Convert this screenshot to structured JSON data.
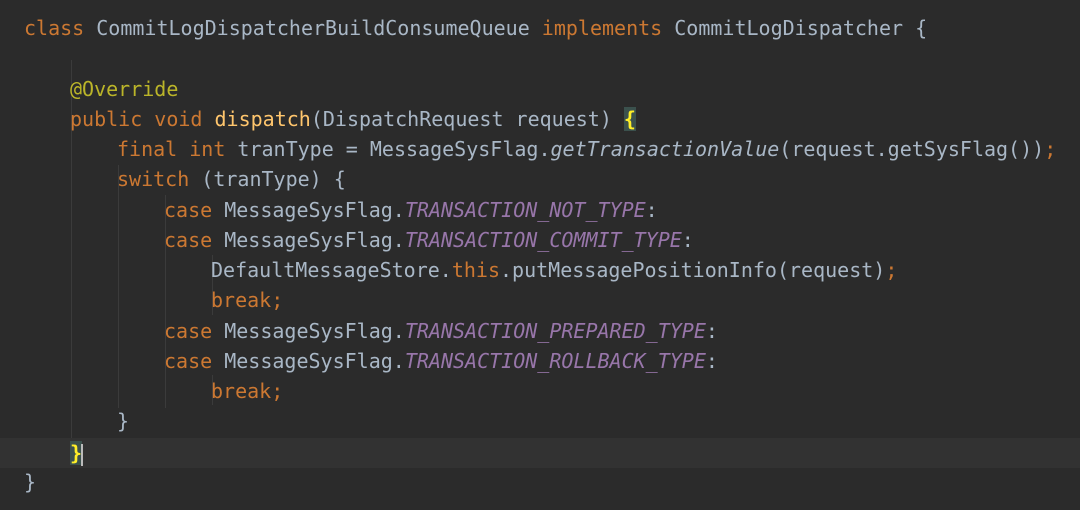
{
  "editor": {
    "language": "Java",
    "theme_colors": {
      "background": "#2b2b2b",
      "keyword": "#cc7832",
      "method": "#ffc66d",
      "annotation": "#bbb529",
      "constant": "#9876aa",
      "text": "#a9b7c6",
      "brace_match": "#ffef28"
    },
    "code": {
      "l1": {
        "kw_class": "class",
        "class_name": " CommitLogDispatcherBuildConsumeQueue ",
        "kw_implements": "implements",
        "iface": " CommitLogDispatcher {"
      },
      "l3": {
        "annotation": "@Override"
      },
      "l4": {
        "kw_public": "public",
        "kw_void": "void",
        "method": "dispatch",
        "params": "(DispatchRequest request) ",
        "brace": "{"
      },
      "l5": {
        "kw_final": "final",
        "kw_int": "int",
        "decl": " tranType = MessageSysFlag.",
        "call": "getTransactionValue",
        "args": "(request.getSysFlag())",
        "semi": ";"
      },
      "l6": {
        "kw_switch": "switch",
        "rest": " (tranType) {"
      },
      "l7": {
        "kw_case": "case",
        "cls": " MessageSysFlag.",
        "const": "TRANSACTION_NOT_TYPE",
        "colon": ":"
      },
      "l8": {
        "kw_case": "case",
        "cls": " MessageSysFlag.",
        "const": "TRANSACTION_COMMIT_TYPE",
        "colon": ":"
      },
      "l9": {
        "pre": "DefaultMessageStore.",
        "kw_this": "this",
        "post": ".putMessagePositionInfo(request)",
        "semi": ";"
      },
      "l10": {
        "kw_break": "break",
        "semi": ";"
      },
      "l11": {
        "kw_case": "case",
        "cls": " MessageSysFlag.",
        "const": "TRANSACTION_PREPARED_TYPE",
        "colon": ":"
      },
      "l12": {
        "kw_case": "case",
        "cls": " MessageSysFlag.",
        "const": "TRANSACTION_ROLLBACK_TYPE",
        "colon": ":"
      },
      "l13": {
        "kw_break": "break",
        "semi": ";"
      },
      "l14": {
        "brace": "}"
      },
      "l15": {
        "brace": "}"
      },
      "l16": {
        "brace": "}"
      }
    }
  }
}
